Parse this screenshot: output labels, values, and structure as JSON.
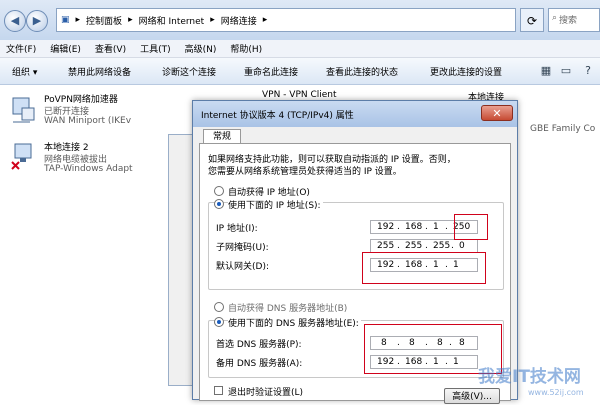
{
  "address_bar": {
    "crumbs": [
      "控制面板",
      "网络和 Internet",
      "网络连接"
    ],
    "search_placeholder": "搜索"
  },
  "menu": [
    "文件(F)",
    "编辑(E)",
    "查看(V)",
    "工具(T)",
    "高级(N)",
    "帮助(H)"
  ],
  "commands": [
    "组织 ▾",
    "禁用此网络设备",
    "诊断这个连接",
    "重命名此连接",
    "查看此连接的状态",
    "更改此连接的设置"
  ],
  "adapters": [
    {
      "name": "PoVPN网络加速器",
      "status": "已断开连接",
      "device": "WAN Miniport (IKEv"
    },
    {
      "name": "本地连接 2",
      "status": "网络电缆被拔出",
      "device": "TAP-Windows Adapt"
    }
  ],
  "background_labels": {
    "vpn": "VPN - VPN Client",
    "local": "本地连接",
    "family": "GBE Family Co"
  },
  "dialog": {
    "title": "Internet 协议版本 4 (TCP/IPv4) 属性",
    "close": "✕",
    "tab": "常规",
    "intro_line1": "如果网络支持此功能，则可以获取自动指派的 IP 设置。否则，",
    "intro_line2": "您需要从网络系统管理员处获得适当的 IP 设置。",
    "auto_ip": "自动获得 IP 地址(O)",
    "manual_ip": "使用下面的 IP 地址(S):",
    "ip_label": "IP 地址(I):",
    "mask_label": "子网掩码(U):",
    "gateway_label": "默认网关(D):",
    "ip_value": [
      "192",
      "168",
      "1",
      "250"
    ],
    "mask_value": [
      "255",
      "255",
      "255",
      "0"
    ],
    "gateway_value": [
      "192",
      "168",
      "1",
      "1"
    ],
    "auto_dns": "自动获得 DNS 服务器地址(B)",
    "manual_dns": "使用下面的 DNS 服务器地址(E):",
    "dns1_label": "首选 DNS 服务器(P):",
    "dns2_label": "备用 DNS 服务器(A):",
    "dns1_value": [
      "8",
      "8",
      "8",
      "8"
    ],
    "dns2_value": [
      "192",
      "168",
      "1",
      "1"
    ],
    "exit_validate": "退出时验证设置(L)",
    "advanced": "高级(V)..."
  },
  "watermark": {
    "main": "我爱IT技术网",
    "url": "www.52ij.com"
  },
  "colors": {
    "highlight": "#d0021b",
    "accent": "#1b5dbd"
  }
}
